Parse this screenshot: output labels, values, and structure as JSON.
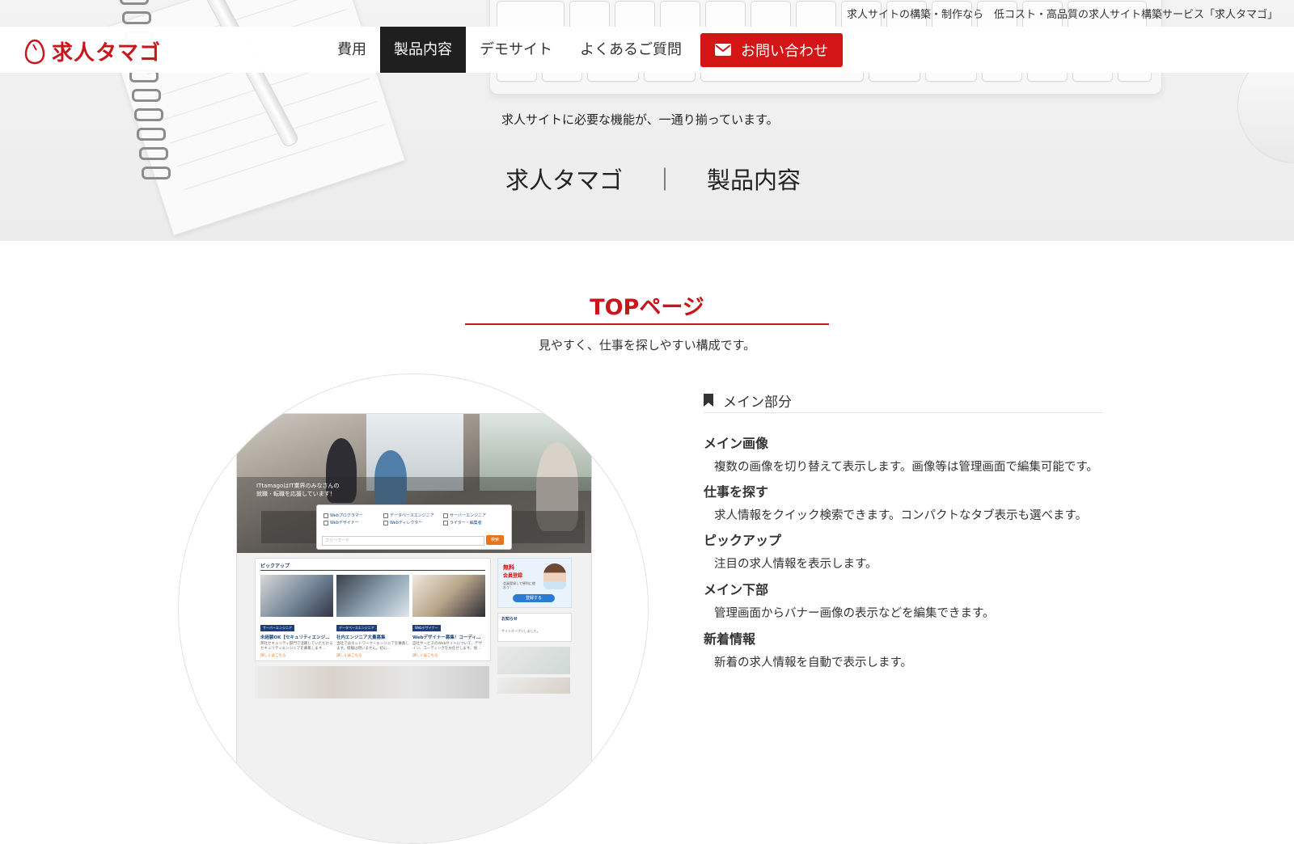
{
  "topline": "求人サイトの構築・制作なら　低コスト・高品質の求人サイト構築サービス「求人タマゴ」",
  "brand": {
    "logo_text": "求人タマゴ",
    "brand_color": "#c8161d"
  },
  "nav": {
    "items": [
      {
        "label": "費用",
        "active": false
      },
      {
        "label": "製品内容",
        "active": true
      },
      {
        "label": "デモサイト",
        "active": false
      },
      {
        "label": "よくあるご質問",
        "active": false
      }
    ],
    "contact_label": "お問い合わせ",
    "contact_icon": "mail-icon",
    "contact_color": "#d31515"
  },
  "hero": {
    "subtitle": "求人サイトに必要な機能が、一通り揃っています。",
    "title_left": "求人タマゴ",
    "separator": "｜",
    "title_right": "製品内容"
  },
  "section": {
    "title": "TOPページ",
    "description": "見やすく、仕事を探しやすい構成です。"
  },
  "mockup": {
    "hero_text_1": "ITtamagoはIT業界のみなさんの",
    "hero_text_2": "就職・転職を応援しています！",
    "search_options": [
      "Webプログラマー",
      "データベースエンジニア",
      "サーバーエンジニア",
      "Webデザイナー",
      "Webディレクター",
      "ライター・編集者"
    ],
    "search_placeholder": "フリーワード",
    "search_button": "検索",
    "pickup_title": "ピックアップ",
    "cards": [
      {
        "tag": "サーバーエンジニア",
        "title": "未経験OK【セキュリティエンジ…",
        "text": "弊社セキュリティ部門で活躍していただけるセキュリティエンジニアを募集します…",
        "more": "詳しくはこちら"
      },
      {
        "tag": "データベースエンジニア",
        "title": "社内エンジニア大量募集",
        "text": "当社ではネットワーク・エンジニアを募集します。経験は問いません。初心…",
        "more": "詳しくはこちら"
      },
      {
        "tag": "Webデザイナー",
        "title": "Webデザイナー募集！コーディ…",
        "text": "自社サービスのWebサイトについて、デザイン、コーディングをお任せします。他…",
        "more": "詳しくはこちら"
      }
    ],
    "banner_line1": "無料",
    "banner_line2": "会員登録",
    "banner_line3": "会員登録して便利に使おう！",
    "banner_button": "登録する",
    "news_title": "お知らせ",
    "news_text": "サイトオープンしました。"
  },
  "features": {
    "heading": "メイン部分",
    "heading_icon": "bookmark-icon",
    "items": [
      {
        "title": "メイン画像",
        "desc": "複数の画像を切り替えて表示します。画像等は管理画面で編集可能です。"
      },
      {
        "title": "仕事を探す",
        "desc": "求人情報をクイック検索できます。コンパクトなタブ表示も選べます。"
      },
      {
        "title": "ピックアップ",
        "desc": "注目の求人情報を表示します。"
      },
      {
        "title": "メイン下部",
        "desc": "管理画面からバナー画像の表示などを編集できます。"
      },
      {
        "title": "新着情報",
        "desc": "新着の求人情報を自動で表示します。"
      }
    ]
  }
}
